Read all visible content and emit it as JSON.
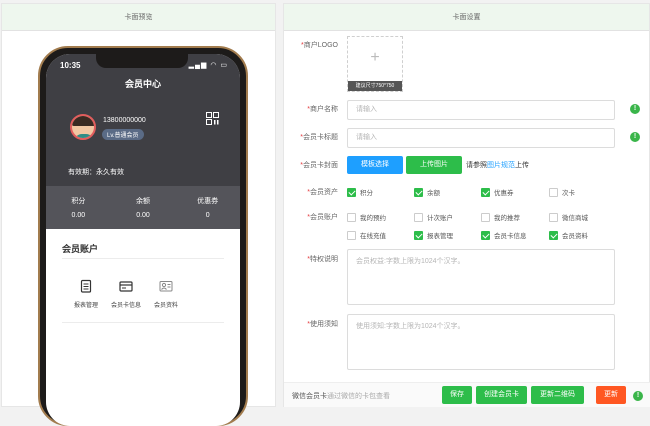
{
  "left_panel": {
    "title": "卡面预览"
  },
  "right_panel": {
    "title": "卡面设置"
  },
  "phone": {
    "time": "10:35",
    "status_icons": "▂▄▆ ◠ ▭",
    "title": "会员中心",
    "phone_number": "13800000000",
    "level": "Lv.普通会员",
    "validity": "有效期：永久有效",
    "stats": [
      {
        "label": "积分",
        "value": "0.00"
      },
      {
        "label": "余额",
        "value": "0.00"
      },
      {
        "label": "优惠券",
        "value": "0"
      }
    ],
    "account_title": "会员账户",
    "account_items": [
      {
        "label": "报表管理",
        "icon": "clipboard-icon"
      },
      {
        "label": "会员卡信息",
        "icon": "card-icon"
      },
      {
        "label": "会员资料",
        "icon": "profile-icon"
      }
    ]
  },
  "form": {
    "logo_label": "商户LOGO",
    "logo_plus": "+",
    "logo_tip": "建议尺寸750*750",
    "name_label": "商户名称",
    "name_placeholder": "请输入",
    "card_title_label": "会员卡标题",
    "card_title_placeholder": "请输入",
    "cover_label": "会员卡封面",
    "template_button": "模板选择",
    "upload_button": "上传图片",
    "cover_text_before": "请参照",
    "cover_link": "图片规范",
    "cover_text_after": "上传",
    "assets_label": "会员资产",
    "assets": [
      {
        "label": "积分",
        "checked": true
      },
      {
        "label": "余额",
        "checked": true
      },
      {
        "label": "优惠券",
        "checked": true
      },
      {
        "label": "次卡",
        "checked": false
      }
    ],
    "account_label": "会员账户",
    "accounts": [
      {
        "label": "我的预约",
        "checked": false
      },
      {
        "label": "计次账户",
        "checked": false
      },
      {
        "label": "我的推荐",
        "checked": false
      },
      {
        "label": "微信商城",
        "checked": false
      },
      {
        "label": "在线充值",
        "checked": false
      },
      {
        "label": "报表管理",
        "checked": true
      },
      {
        "label": "会员卡信息",
        "checked": true
      },
      {
        "label": "会员资料",
        "checked": true
      }
    ],
    "privilege_label": "特权说明",
    "privilege_placeholder": "会员权益:字数上限为1024个汉字。",
    "notice_label": "使用须知",
    "notice_placeholder": "使用须知:字数上限为1024个汉字。",
    "required_mark": "*",
    "warn_mark": "!"
  },
  "footer": {
    "text": "微信会员卡",
    "hint": "通过微信的卡包查看",
    "save": "保存",
    "create": "创建会员卡",
    "update_qr": "更新二维码",
    "refresh": "更新",
    "warn": "!"
  },
  "colors": {
    "green": "#2dbd4a",
    "blue": "#1e9fff",
    "orange": "#ff5722",
    "phone_frame": "#a27c4e"
  }
}
